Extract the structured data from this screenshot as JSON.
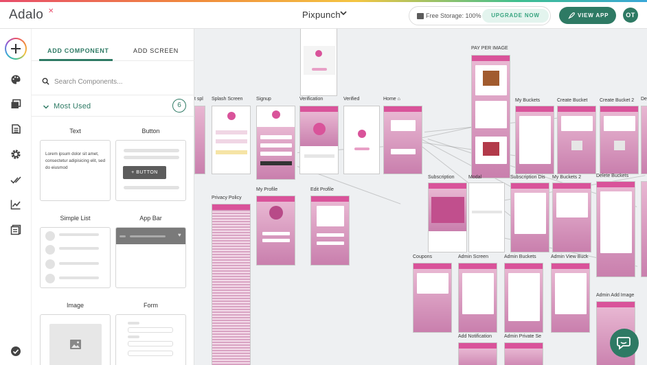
{
  "header": {
    "logo": "Adalo",
    "project_name": "Pixpunch",
    "storage_text": "Free Storage: 100%",
    "upgrade_label": "UPGRADE NOW",
    "view_app_label": "VIEW APP",
    "avatar_initials": "OT"
  },
  "rail": {
    "icons": [
      "plus-icon",
      "palette-icon",
      "screens-icon",
      "database-icon",
      "settings-icon",
      "publish-icon",
      "analytics-icon",
      "documents-icon",
      "check-badge-icon"
    ]
  },
  "panel": {
    "tabs": [
      {
        "label": "ADD COMPONENT",
        "active": true
      },
      {
        "label": "ADD SCREEN",
        "active": false
      }
    ],
    "search_placeholder": "Search Components...",
    "section_title": "Most Used",
    "section_count": "6",
    "components": [
      {
        "label": "Text",
        "preview_text": "Lorem ipsum dolor sit amet, consectetur adipisicing elit, sed do eiusmod"
      },
      {
        "label": "Button",
        "preview_button": "BUTTON"
      },
      {
        "label": "Simple List"
      },
      {
        "label": "App Bar"
      },
      {
        "label": "Image"
      },
      {
        "label": "Form"
      }
    ]
  },
  "canvas": {
    "screen_labels": {
      "splash_partial": "t spl",
      "splash": "Splash Screen",
      "signup": "Signup",
      "verification": "Verification",
      "verified": "Verified",
      "home": "Home",
      "pay_per_image": "PAY PER IMAGE",
      "my_buckets": "My Buckets",
      "create_bucket": "Create Bucket",
      "create_bucket_2": "Create Bucket 2",
      "de_partial": "De",
      "subscription": "Subscription",
      "modal": "Modal",
      "subscription_dis": "Subscription Dis",
      "my_buckets_2": "My Buckets 2",
      "delete_buckets": "Delete Buckets",
      "privacy_policy": "Privacy Policy",
      "my_profile": "My Profile",
      "edit_profile": "Edit Profile",
      "coupons": "Coupons",
      "admin_screen": "Admin Screen",
      "admin_buckets": "Admin Buckets",
      "admin_view_buck": "Admin View Buck",
      "admin_add_image": "Admin Add Image",
      "add_notification": "Add Notification",
      "admin_private_se": "Admin Private Se"
    }
  }
}
